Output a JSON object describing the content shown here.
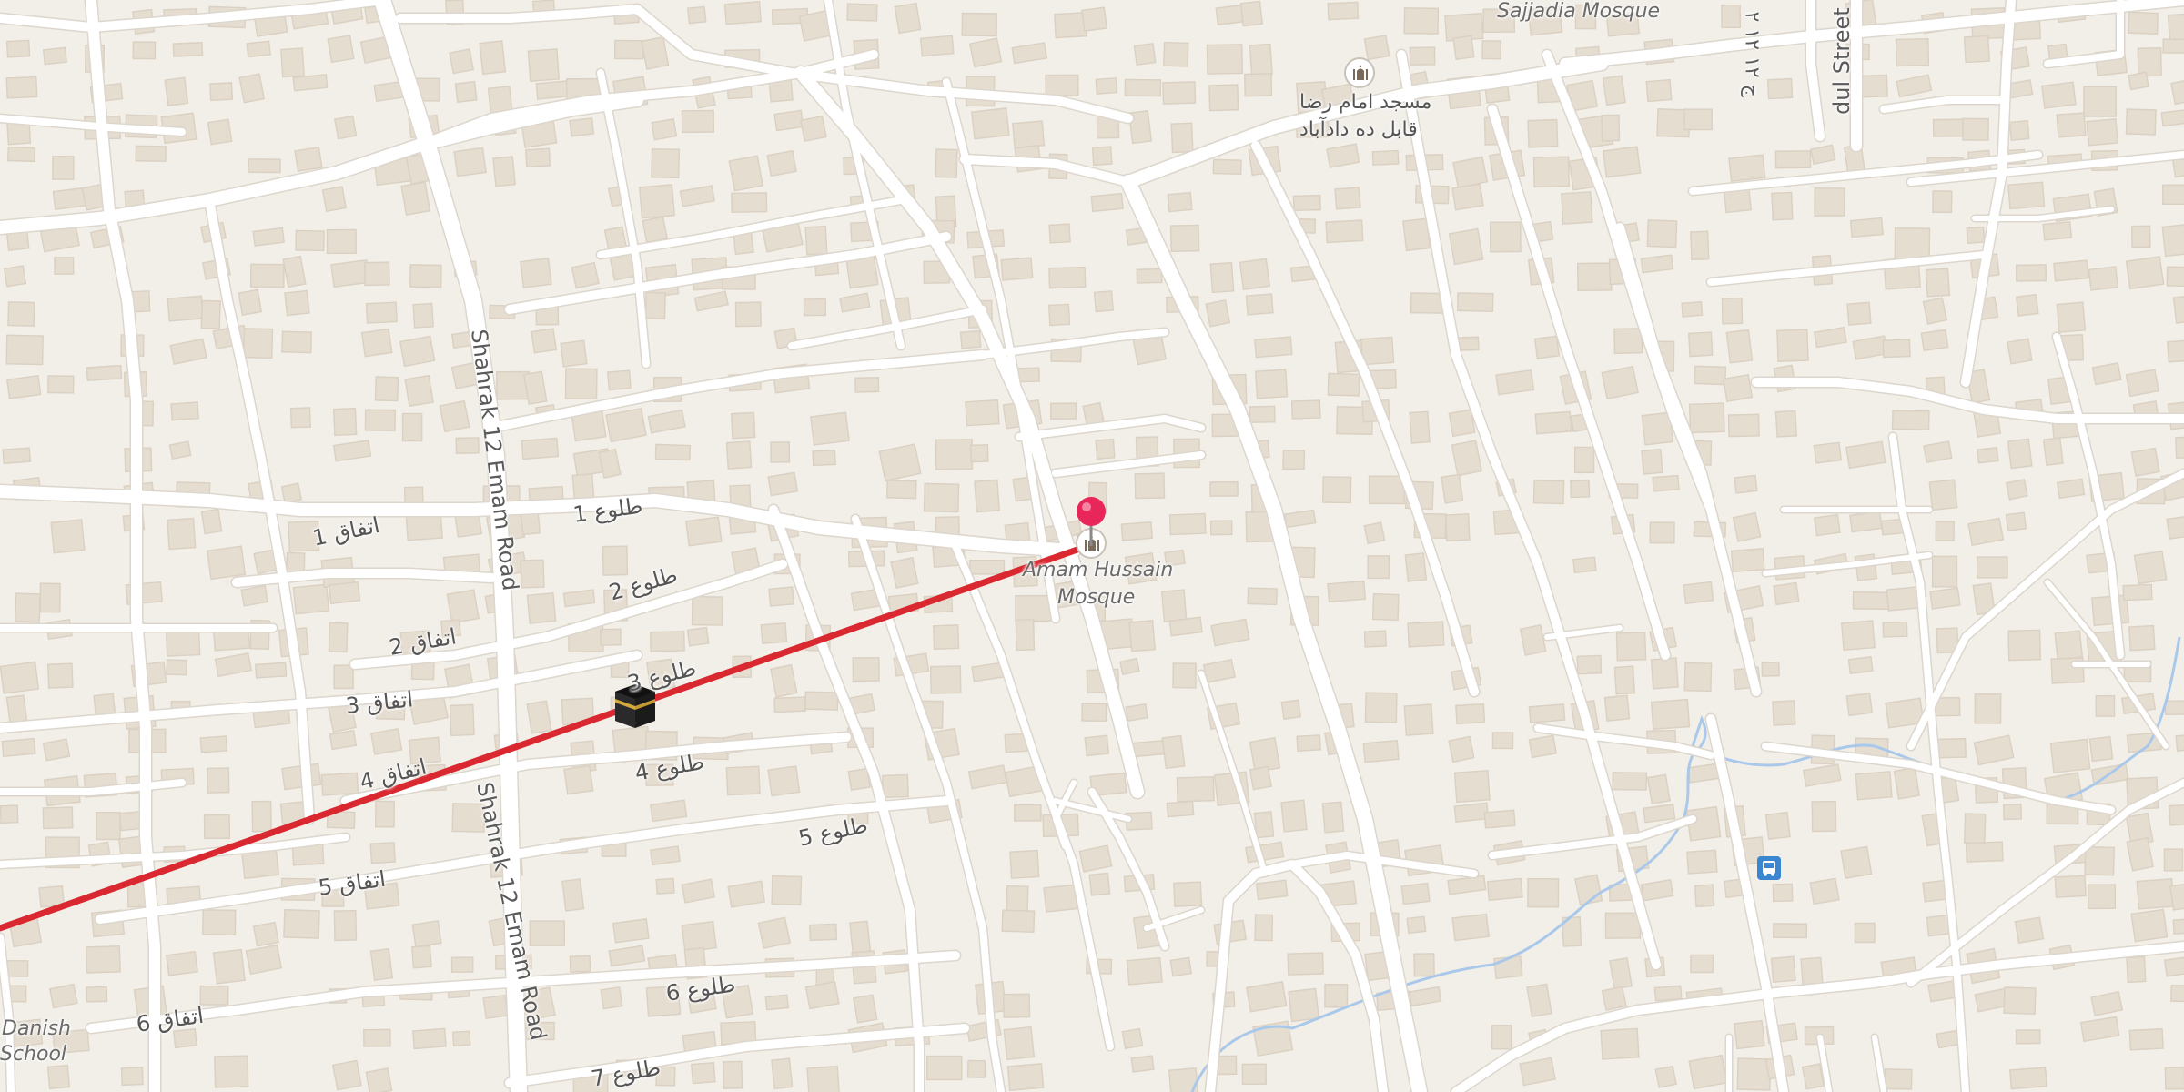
{
  "map": {
    "poi_labels": {
      "sajjadia": "Sajjadia Mosque",
      "imam_reza_line1": "مسجد امام رضا",
      "imam_reza_line2": "قابل ده دادآباد",
      "amam_hussain_line1": "Amam Hussain",
      "amam_hussain_line2": "Mosque",
      "danish_line1": "Danish",
      "danish_line2": "School"
    },
    "road_labels": {
      "shahrak_1": "Shahrak 12 Emam Road",
      "shahrak_2": "Shahrak 12 Emam Road",
      "street_right": "dul Street",
      "right_vertical": "ج ۱۲ ۱۲ ۲",
      "tolue_1": "طلوع 1",
      "tolue_2": "طلوع 2",
      "tolue_3": "طلوع 3",
      "tolue_4": "طلوع 4",
      "tolue_5": "طلوع 5",
      "tolue_6": "طلوع 6",
      "tolue_7": "طلوع 7",
      "etefaq_1": "اتفاق 1",
      "etefaq_2": "اتفاق 2",
      "etefaq_3": "اتفاق 3",
      "etefaq_4": "اتفاق 4",
      "etefaq_5": "اتفاق 5",
      "etefaq_6": "اتفاق 6"
    },
    "icons": {
      "destination_pin": "location-pin-icon",
      "mosque": "mosque-icon",
      "kaaba": "kaaba-icon",
      "bus_stop": "bus-stop-icon"
    },
    "colors": {
      "background": "#f2efe9",
      "road": "#ffffff",
      "building": "#e6ddd1",
      "route_line": "#d9282f",
      "pin": "#e8265a",
      "stream": "#a9c8ea",
      "bus": "#3b86d1"
    }
  }
}
